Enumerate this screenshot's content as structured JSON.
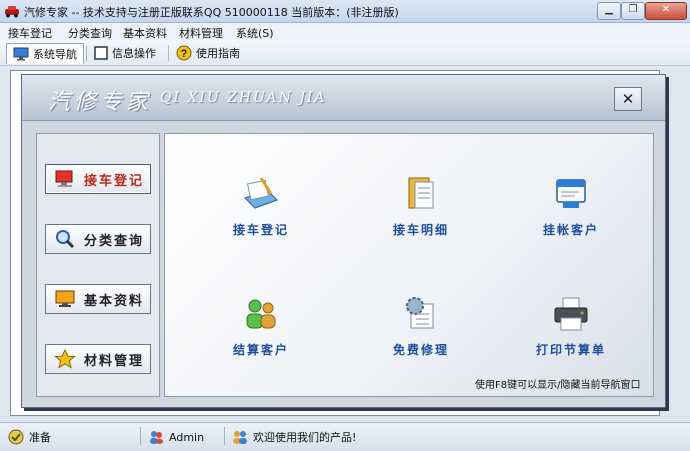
{
  "window": {
    "title": "汽修专家 -- 技术支持与注册正版联系QQ 510000118   当前版本：(非注册版)",
    "minimize": "▁",
    "restore": "❐",
    "close": "✕"
  },
  "menu": {
    "items": [
      "接车登记",
      "分类查询",
      "基本资料",
      "材料管理",
      "系统(S)"
    ]
  },
  "toolbar": {
    "tabs": [
      {
        "label": "系统导航",
        "icon": "monitor-icon"
      },
      {
        "label": "信息操作",
        "icon": "square-icon"
      },
      {
        "label": "使用指南",
        "icon": "help-icon"
      }
    ]
  },
  "banner": {
    "title_cn": "汽修专家",
    "title_en": "QI XIU ZHUAN JIA",
    "close": "✕"
  },
  "sidebar": {
    "items": [
      {
        "label": "接车登记",
        "icon": "computer-icon"
      },
      {
        "label": "分类查询",
        "icon": "magnifier-icon"
      },
      {
        "label": "基本资料",
        "icon": "monitor-icon"
      },
      {
        "label": "材料管理",
        "icon": "star-icon"
      }
    ]
  },
  "tiles": {
    "items": [
      {
        "label": "接车登记",
        "icon": "pen-paper-icon"
      },
      {
        "label": "接车明细",
        "icon": "folder-doc-icon"
      },
      {
        "label": "挂帐客户",
        "icon": "card-icon"
      },
      {
        "label": "结算客户",
        "icon": "users-icon"
      },
      {
        "label": "免费修理",
        "icon": "gear-doc-icon"
      },
      {
        "label": "打印节算单",
        "icon": "printer-icon"
      }
    ]
  },
  "hint": "使用F8键可以显示/隐藏当前导航窗口",
  "status": {
    "ready": "准备",
    "user": "Admin",
    "welcome": "欢迎使用我们的产品!"
  },
  "colors": {
    "accent_red": "#c0281b",
    "tile_blue": "#1d4f9e"
  }
}
